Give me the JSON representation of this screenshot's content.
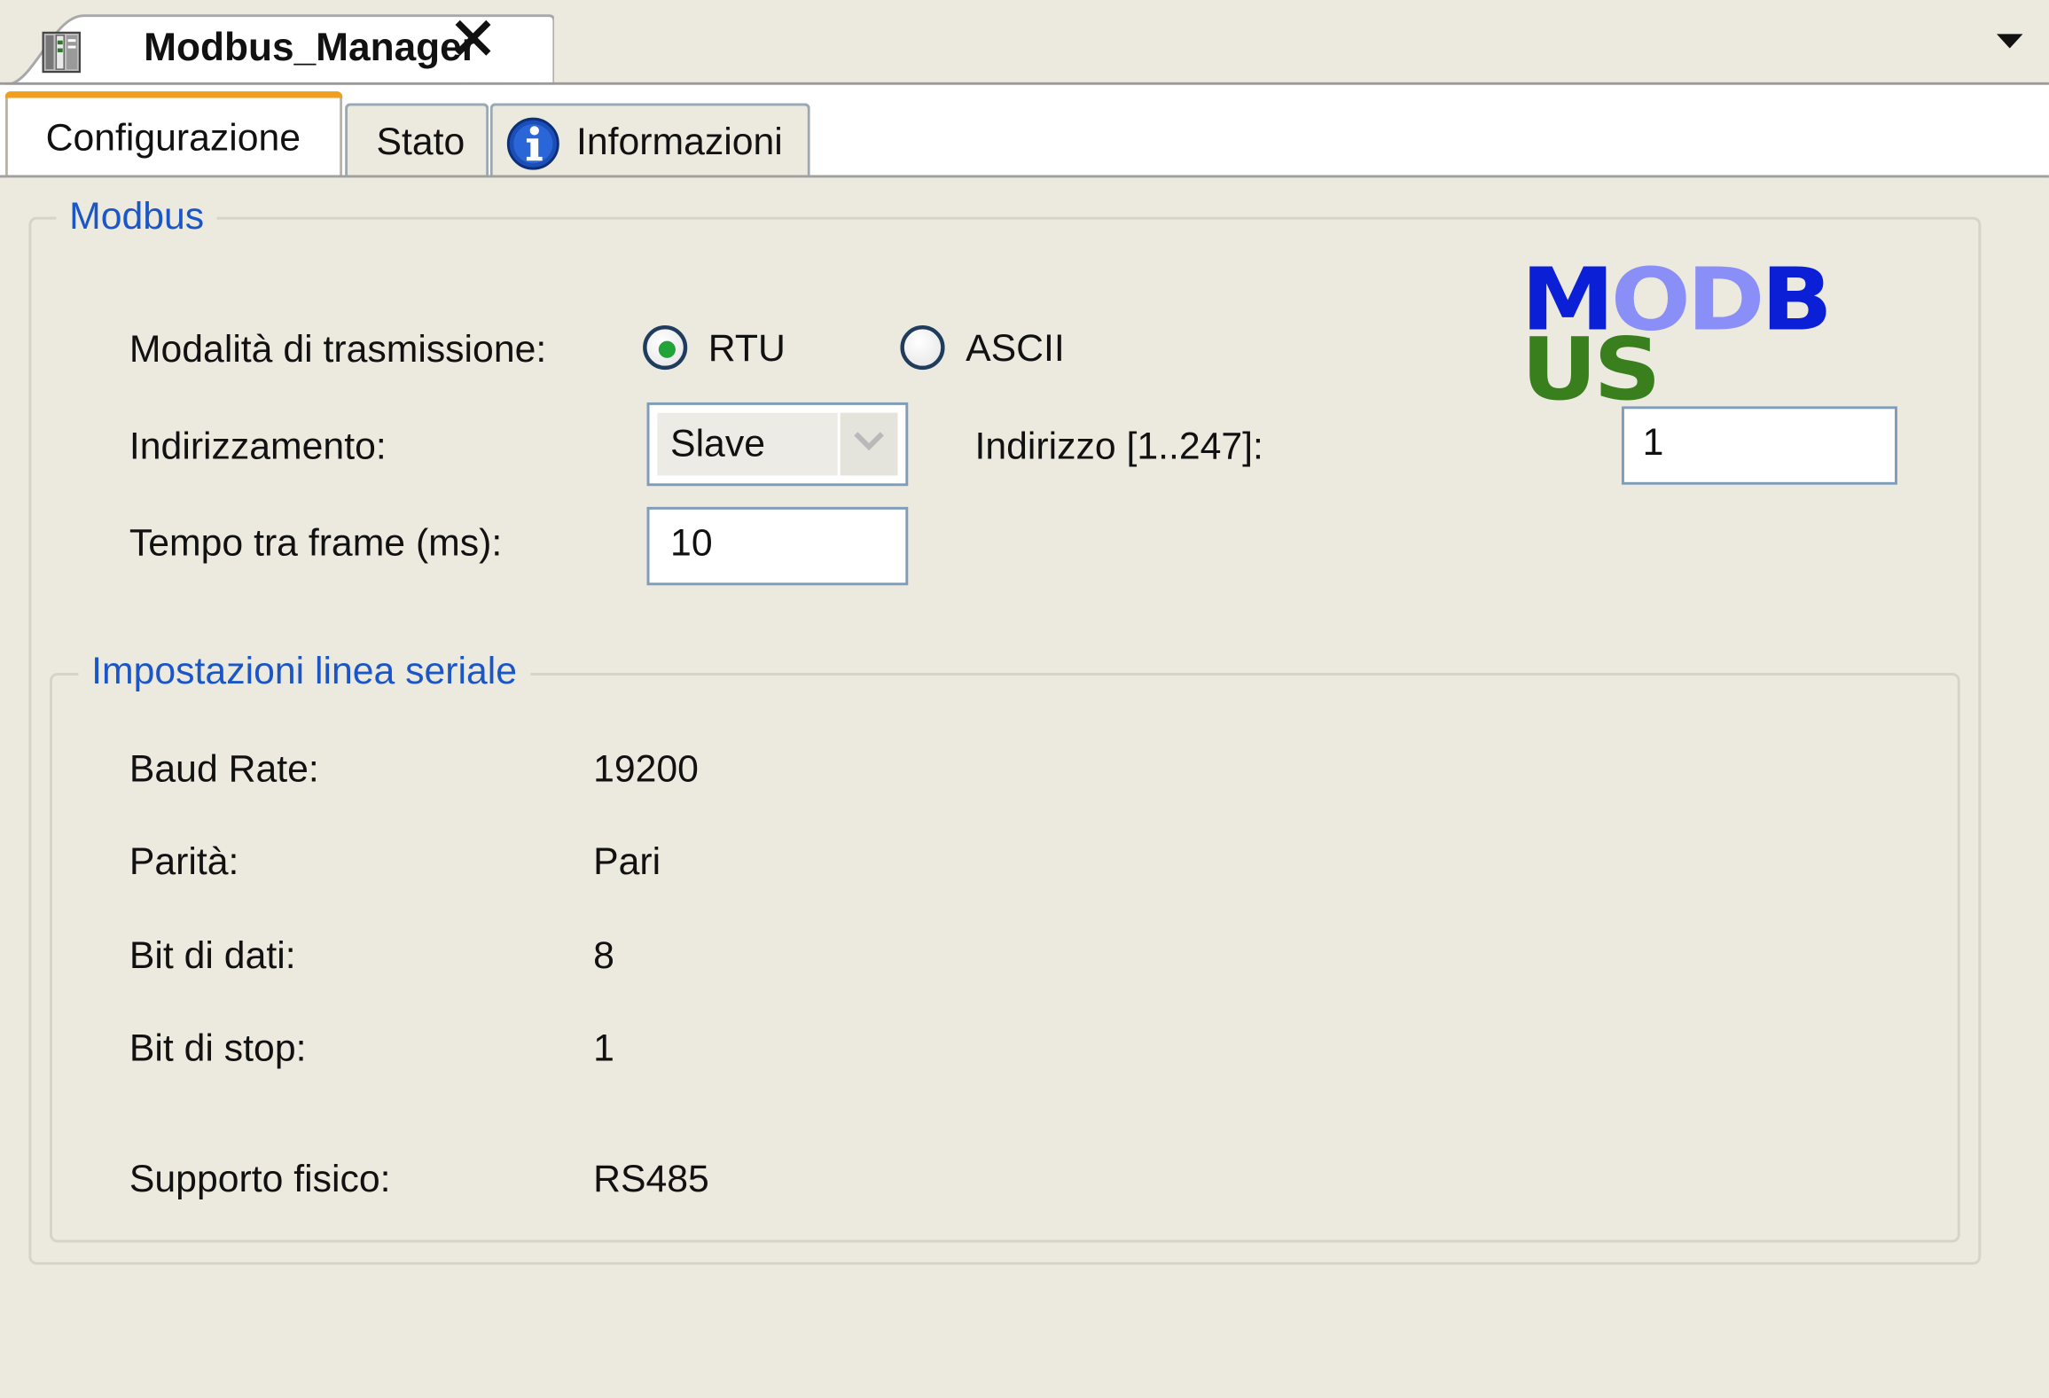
{
  "editor_tab": {
    "title": "Modbus_Manager",
    "icon": "device-icon",
    "close_icon": "close-icon"
  },
  "tabs": [
    {
      "label": "Configurazione",
      "active": true
    },
    {
      "label": "Stato",
      "active": false
    },
    {
      "label": "Informazioni",
      "active": false,
      "icon": "info-icon"
    }
  ],
  "modbus": {
    "group_title": "Modbus",
    "logo_text": "MODBUS",
    "logo_colors": [
      "#0a1fd6",
      "#8a8ef7",
      "#0a1fd6",
      "#3a7f1e"
    ],
    "transmission_label": "Modalità di trasmissione:",
    "transmission_options": [
      {
        "label": "RTU",
        "selected": true
      },
      {
        "label": "ASCII",
        "selected": false
      }
    ],
    "addressing_label": "Indirizzamento:",
    "addressing_value": "Slave",
    "address_label": "Indirizzo [1..247]:",
    "address_value": "1",
    "frame_time_label": "Tempo tra frame (ms):",
    "frame_time_value": "10"
  },
  "serial": {
    "group_title": "Impostazioni linea seriale",
    "rows": [
      {
        "label": "Baud Rate:",
        "value": "19200"
      },
      {
        "label": "Parità:",
        "value": "Pari"
      },
      {
        "label": "Bit di dati:",
        "value": "8"
      },
      {
        "label": "Bit di stop:",
        "value": "1"
      },
      {
        "label": "Supporto fisico:",
        "value": "RS485"
      }
    ]
  },
  "colors": {
    "accent": "#f29d1c",
    "group_title": "#1a56c8",
    "radio_selected": "#22a33a"
  }
}
